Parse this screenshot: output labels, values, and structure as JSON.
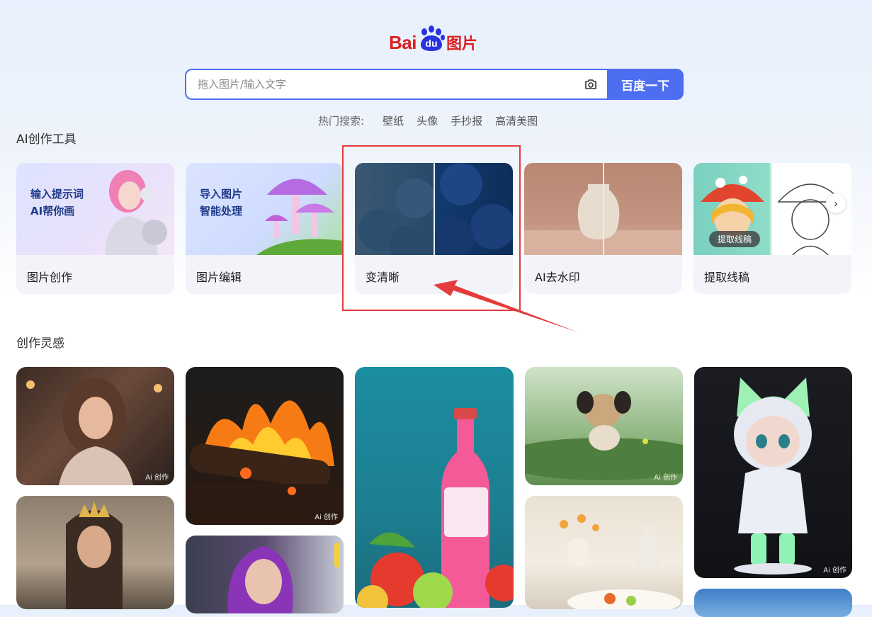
{
  "logo": {
    "bai": "Bai",
    "du": "du",
    "pic": "图片"
  },
  "search": {
    "placeholder": "拖入图片/输入文字",
    "camera_icon": "camera-icon",
    "button_label": "百度一下"
  },
  "hot_search": {
    "label": "热门搜索:",
    "keywords": [
      "壁纸",
      "头像",
      "手抄报",
      "高清美图"
    ]
  },
  "ai_tools": {
    "title": "AI创作工具",
    "cards": [
      {
        "name": "图片创作",
        "promo_line1": "输入提示词",
        "promo_line2": "AI帮你画"
      },
      {
        "name": "图片编辑",
        "promo_line1": "导入图片",
        "promo_line2": "智能处理"
      },
      {
        "name": "变清晰"
      },
      {
        "name": "AI去水印"
      },
      {
        "name": "提取线稿",
        "chip": "提取线稿",
        "next_icon": "chevron-right-icon"
      }
    ]
  },
  "inspiration": {
    "title": "创作灵感",
    "ai_tag": "Ai 创作"
  },
  "colors": {
    "accent": "#4e6ef2",
    "brand_red": "#de1f1f",
    "annotation_red": "#e43c3c"
  }
}
